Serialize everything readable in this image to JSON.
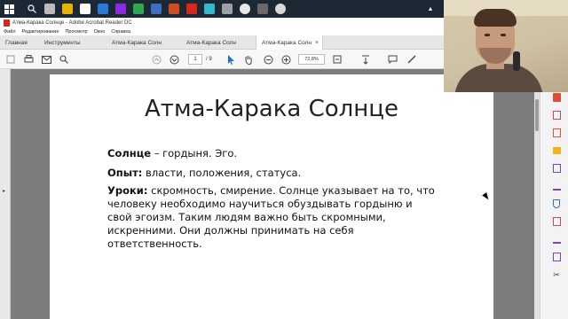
{
  "window": {
    "title": "Атма-Каракa Солнце - Adobe Acrobat Reader DC"
  },
  "menu": [
    "Файл",
    "Редактирование",
    "Просмотр",
    "Окно",
    "Справка"
  ],
  "tabs": [
    {
      "label": "Главная"
    },
    {
      "label": "Инструменты"
    },
    {
      "label": "Атма-Карака Солн"
    },
    {
      "label": "Атма-Карака Солн"
    },
    {
      "label": "Атма-Карака Солн"
    }
  ],
  "toolbar": {
    "page_current": "1",
    "page_total": "/ 9",
    "zoom": "72,8%"
  },
  "document": {
    "title": "Атма-Карака Солнце",
    "p1_label": "Солнце",
    "p1_text": " – гордыня. Эго.",
    "p2_label": "Опыт:",
    "p2_text": " власти, положения, статуса.",
    "p3_label": "Уроки:",
    "p3_text": " скромность, смирение. Солнце указывает на то, что человеку необходимо научиться обуздывать гордыню и свой эгоизм. Таким людям важно быть скромными, искренними. Они должны принимать на себя ответственность."
  },
  "colors": {
    "taskbar": "#1c2833",
    "acrobat_red": "#d4291d",
    "viewer_bg": "#7d7d7d"
  }
}
